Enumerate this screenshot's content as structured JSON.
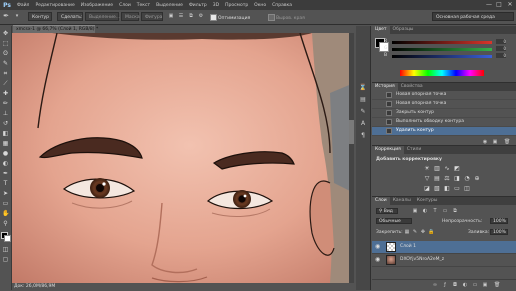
{
  "app": {
    "logo": "Ps"
  },
  "menu": [
    "Файл",
    "Редактирование",
    "Изображение",
    "Слои",
    "Текст",
    "Выделение",
    "Фильтр",
    "3D",
    "Просмотр",
    "Окно",
    "Справка"
  ],
  "window_controls": [
    "—",
    "□",
    "✕"
  ],
  "options": {
    "path_mode": "Контур",
    "make_button": "Сделать:",
    "selection_button": "Выделение...",
    "mask_button": "Маска",
    "shape_button": "Фигура",
    "optimization_label": "Оптимизация",
    "align_edges_label": "Выров. края",
    "workspace": "Основная рабочая среда"
  },
  "document": {
    "tab_title": "xmcsx-1 @ 66,7% (Слой 1, RGB/8) *",
    "status": "Док: 26,0M/86,9M"
  },
  "color_panel": {
    "tabs": [
      "Цвет",
      "Образцы"
    ],
    "channels": [
      {
        "label": "R",
        "value": "0",
        "color": "#d9352b"
      },
      {
        "label": "G",
        "value": "0",
        "color": "#35b24a"
      },
      {
        "label": "B",
        "value": "0",
        "color": "#3a5fd9"
      }
    ]
  },
  "history_panel": {
    "tabs": [
      "История",
      "Свойства"
    ],
    "items": [
      {
        "label": "Новая опорная точка",
        "selected": false
      },
      {
        "label": "Новая опорная точка",
        "selected": false
      },
      {
        "label": "Закрыть контур",
        "selected": false
      },
      {
        "label": "Выполнить обводку контура",
        "selected": false
      },
      {
        "label": "Удалить контур",
        "selected": true
      }
    ]
  },
  "adjustments_panel": {
    "tabs": [
      "Коррекция",
      "Стили"
    ],
    "title": "Добавить корректировку"
  },
  "layers_panel": {
    "tabs": [
      "Слои",
      "Каналы",
      "Контуры"
    ],
    "kind_label": "Вид",
    "blend_mode": "Обычные",
    "opacity_label": "Непрозрачность:",
    "opacity_value": "100%",
    "lock_label": "Закрепить:",
    "fill_label": "Заливка:",
    "fill_value": "100%",
    "layers": [
      {
        "name": "Слой 1",
        "selected": true
      },
      {
        "name": "DXOYjv5NroA2eM_z",
        "selected": false
      }
    ]
  }
}
